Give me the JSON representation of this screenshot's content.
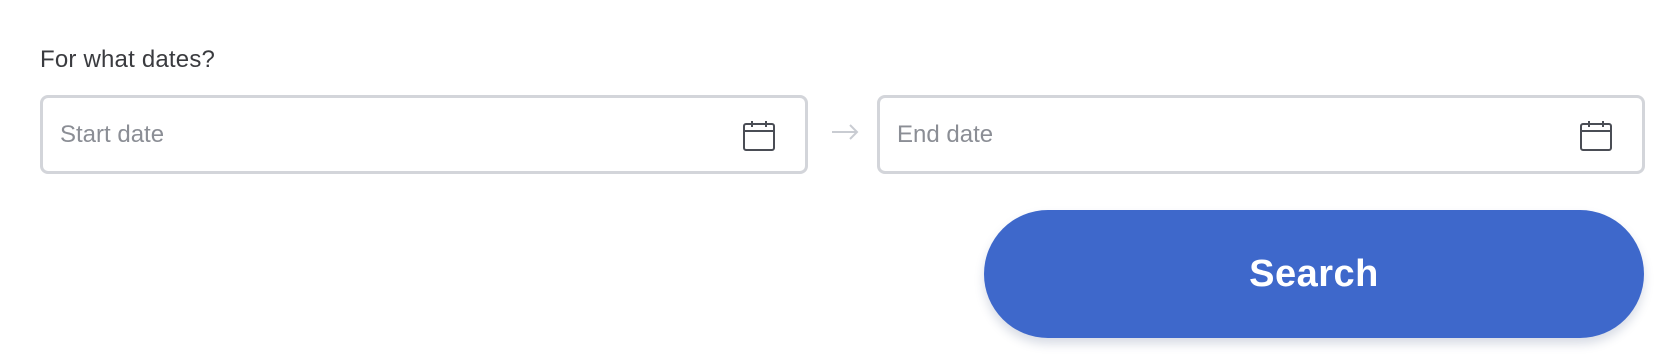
{
  "question": {
    "label": "For what dates?"
  },
  "date_range": {
    "start": {
      "placeholder": "Start date",
      "icon": "calendar-icon"
    },
    "separator_icon": "arrow-right-icon",
    "end": {
      "placeholder": "End date",
      "icon": "calendar-icon"
    }
  },
  "actions": {
    "search_label": "Search"
  },
  "colors": {
    "accent": "#3e68cb",
    "field_border": "#d3d5da",
    "placeholder_text": "#8b8e95",
    "label_text": "#3a3b3f"
  }
}
